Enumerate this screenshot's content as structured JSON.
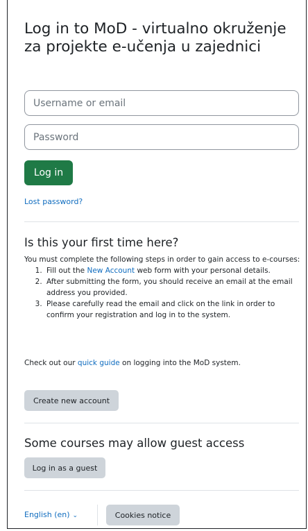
{
  "login": {
    "title": "Log in to MoD - virtualno okruženje za projekte e-učenja u zajednici",
    "username_placeholder": "Username or email",
    "password_placeholder": "Password",
    "login_button": "Log in",
    "lost_password": "Lost password?"
  },
  "first_time": {
    "heading": "Is this your first time here?",
    "intro": "You must complete the following steps in order to gain access to e-courses:",
    "step1_before": "Fill out the ",
    "step1_link": "New Account",
    "step1_after": " web form with your personal details.",
    "step2": "After submitting the form, you should receive an email at the email address you provided.",
    "step3": "Please carefully read the email and click on the link in order to confirm your registration and log in to the system.",
    "guide_before": "Check out our ",
    "guide_link": "quick guide",
    "guide_after": " on logging into the MoD system.",
    "create_button": "Create new account"
  },
  "guest": {
    "heading": "Some courses may allow guest access",
    "button": "Log in as a guest"
  },
  "footer": {
    "language": "English (en)",
    "cookies_button": "Cookies notice"
  },
  "colors": {
    "primary": "#1f7a46",
    "link": "#0f6cbf",
    "secondary_button": "#ced4da"
  },
  "icons": {
    "language_dropdown": "chevron-down-icon"
  }
}
